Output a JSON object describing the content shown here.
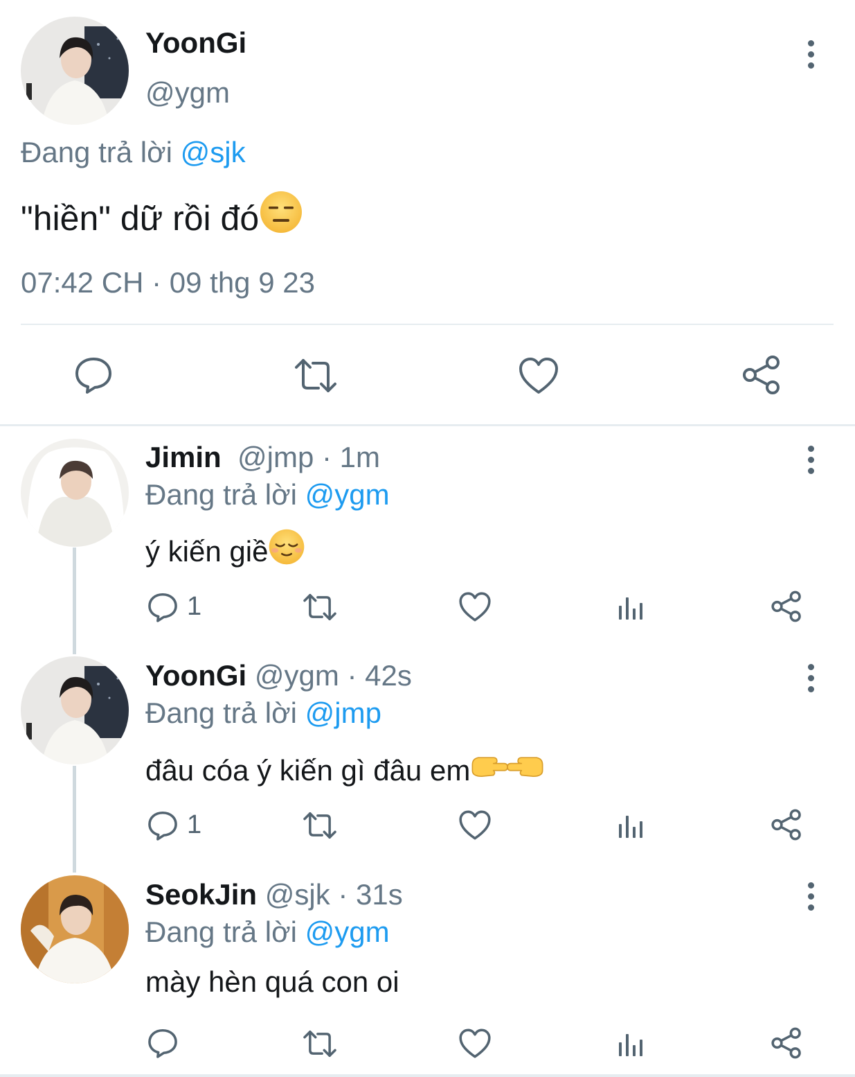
{
  "main_tweet": {
    "author_name": "YoonGi",
    "handle": "@ygm",
    "reply_prefix": "Đang trả lời",
    "reply_to": "@sjk",
    "text": "\"hiền\" dữ rồi đó",
    "timestamp": "07:42 CH · 09 thg 9 23"
  },
  "replies": [
    {
      "author_name": "Jimin",
      "handle_time": "@jmp · 1m",
      "reply_prefix": "Đang trả lời",
      "reply_to": "@ygm",
      "text": "ý kiến giề",
      "reply_count": "1"
    },
    {
      "author_name": "YoonGi",
      "handle_time": "@ygm · 42s",
      "reply_prefix": "Đang trả lời",
      "reply_to": "@jmp",
      "text": "đâu cóa ý kiến gì đâu em",
      "reply_count": "1"
    },
    {
      "author_name": "SeokJin",
      "handle_time": "@sjk · 31s",
      "reply_prefix": "Đang trả lời",
      "reply_to": "@ygm",
      "text": "mày hèn quá con oi",
      "reply_count": ""
    }
  ],
  "colors": {
    "link": "#1d9bf0",
    "muted": "#657786",
    "icon": "#536471",
    "text": "#14171a"
  }
}
